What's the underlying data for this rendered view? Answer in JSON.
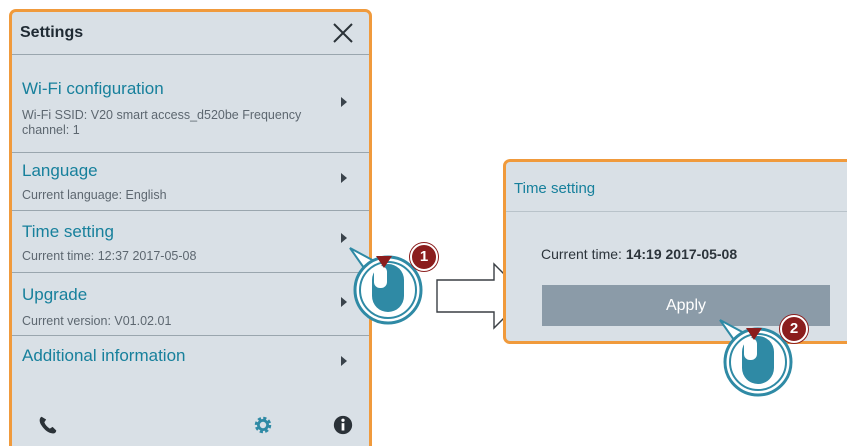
{
  "settings": {
    "title": "Settings",
    "items": [
      {
        "label": "Wi-Fi configuration",
        "sub1": "Wi-Fi SSID: V20 smart access_d520be   Frequency",
        "sub2": "channel: 1"
      },
      {
        "label": "Language",
        "sub1": "Current language: English"
      },
      {
        "label": "Time setting",
        "sub1": "Current time: 12:37 2017-05-08"
      },
      {
        "label": "Upgrade",
        "sub1": "Current version: V01.02.01"
      },
      {
        "label": "Additional information"
      }
    ],
    "bottom_icons": [
      "phone-icon",
      "gear-icon",
      "info-icon"
    ]
  },
  "time_setting": {
    "title": "Time setting",
    "current_time_label": "Current time:",
    "current_time_value": "14:19 2017-05-08",
    "apply_label": "Apply"
  },
  "annotations": {
    "step1": "1",
    "step2": "2"
  },
  "colors": {
    "panel_border": "#f09a3c",
    "panel_bg": "#d9e0e6",
    "link_text": "#17809c",
    "apply_bg": "#8b9ba8",
    "accent_cursor": "#2f8aa5",
    "badge": "#8b1d1d"
  }
}
